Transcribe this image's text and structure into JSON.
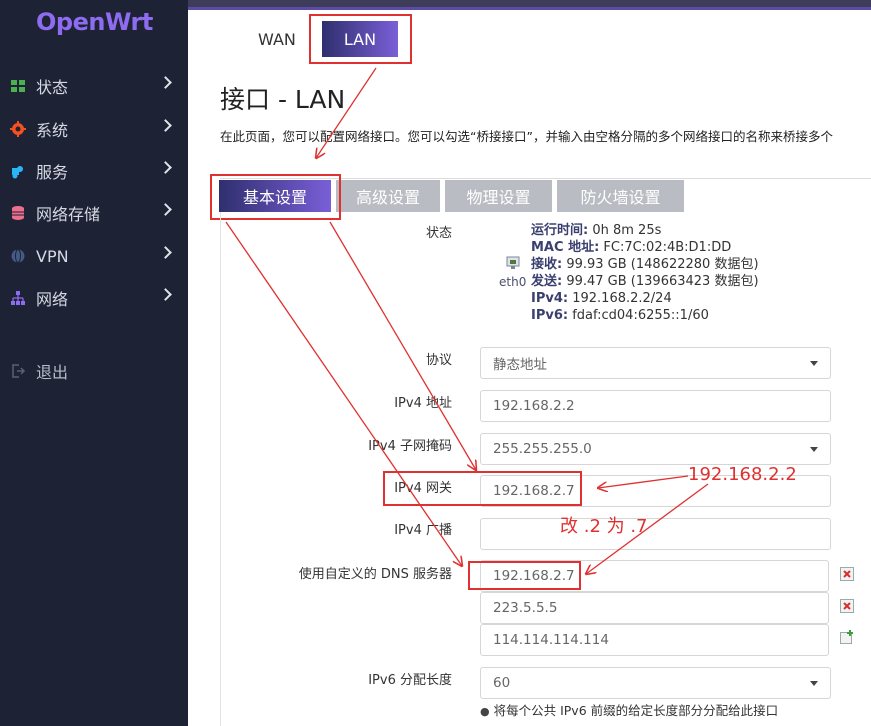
{
  "app": {
    "logo": "OpenWrt"
  },
  "sidebar": {
    "items": [
      {
        "label": "状态",
        "icon": "dashboard-icon",
        "color": "#4caf50"
      },
      {
        "label": "系统",
        "icon": "gear-icon",
        "color": "#f4511e"
      },
      {
        "label": "服务",
        "icon": "puzzle-icon",
        "color": "#29b6f6"
      },
      {
        "label": "网络存储",
        "icon": "database-icon",
        "color": "#ec6f8e"
      },
      {
        "label": "VPN",
        "icon": "globe-icon",
        "color": "#455a84"
      },
      {
        "label": "网络",
        "icon": "network-icon",
        "color": "#8e6cf0"
      }
    ],
    "logout": {
      "label": "退出",
      "icon": "logout-icon"
    }
  },
  "top_tabs": {
    "wan": "WAN",
    "lan": "LAN"
  },
  "page": {
    "title": "接口 - LAN",
    "description": "在此页面，您可以配置网络接口。您可以勾选“桥接接口”，并输入由空格分隔的多个网络接口的名称来桥接多个"
  },
  "sub_tabs": [
    "基本设置",
    "高级设置",
    "物理设置",
    "防火墙设置"
  ],
  "status": {
    "label": "状态",
    "interface": "eth0",
    "lines": [
      {
        "key": "运行时间:",
        "value": " 0h 8m 25s"
      },
      {
        "key": "MAC 地址:",
        "value": " FC:7C:02:4B:D1:DD"
      },
      {
        "key": "接收:",
        "value": " 99.93 GB (148622280 数据包)"
      },
      {
        "key": "发送:",
        "value": " 99.47 GB (139663423 数据包)"
      },
      {
        "key": "IPv4:",
        "value": " 192.168.2.2/24"
      },
      {
        "key": "IPv6:",
        "value": " fdaf:cd04:6255::1/60"
      }
    ]
  },
  "form": {
    "protocol": {
      "label": "协议",
      "value": "静态地址"
    },
    "ipv4_addr": {
      "label": "IPv4 地址",
      "value": "192.168.2.2"
    },
    "netmask": {
      "label": "IPv4 子网掩码",
      "value": "255.255.255.0"
    },
    "gateway": {
      "label": "IPv4 网关",
      "value": "192.168.2.7"
    },
    "broadcast": {
      "label": "IPv4 广播",
      "value": ""
    },
    "dns": {
      "label": "使用自定义的 DNS 服务器",
      "values": [
        "192.168.2.7",
        "223.5.5.5",
        "114.114.114.114"
      ]
    },
    "ipv6_len": {
      "label": "IPv6 分配长度",
      "value": "60"
    },
    "ipv6_note": "将每个公共 IPv6 前缀的给定长度部分分配给此接口"
  },
  "annotations": {
    "ip": "192.168.2.2",
    "change": "改 .2 为 .7"
  }
}
